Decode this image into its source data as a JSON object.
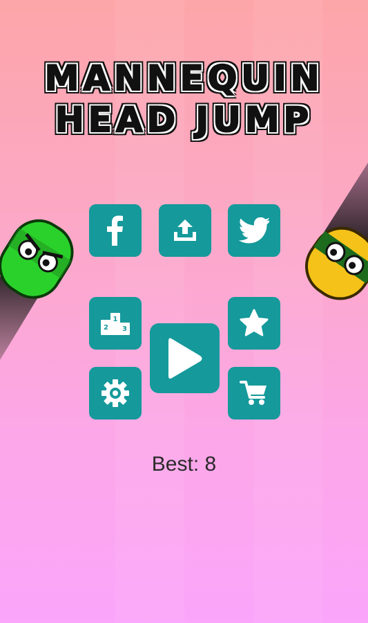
{
  "title": {
    "line1": "MANNEQUIN",
    "line2": "HEAD JUMP"
  },
  "buttons": {
    "facebook": {
      "icon": "facebook-icon"
    },
    "share": {
      "icon": "share-icon"
    },
    "twitter": {
      "icon": "twitter-icon"
    },
    "leaderboard": {
      "icon": "podium-icon",
      "places": [
        "1",
        "2",
        "3"
      ]
    },
    "play": {
      "icon": "play-icon"
    },
    "rate": {
      "icon": "star-icon"
    },
    "settings": {
      "icon": "gear-icon"
    },
    "shop": {
      "icon": "cart-icon"
    }
  },
  "best": "Best: 8",
  "colors": {
    "button": "#15999b",
    "background_top": "#fda6a9",
    "background_bottom": "#fba5fb",
    "left_character": "#2bd12b",
    "right_character": "#f5c21a"
  }
}
